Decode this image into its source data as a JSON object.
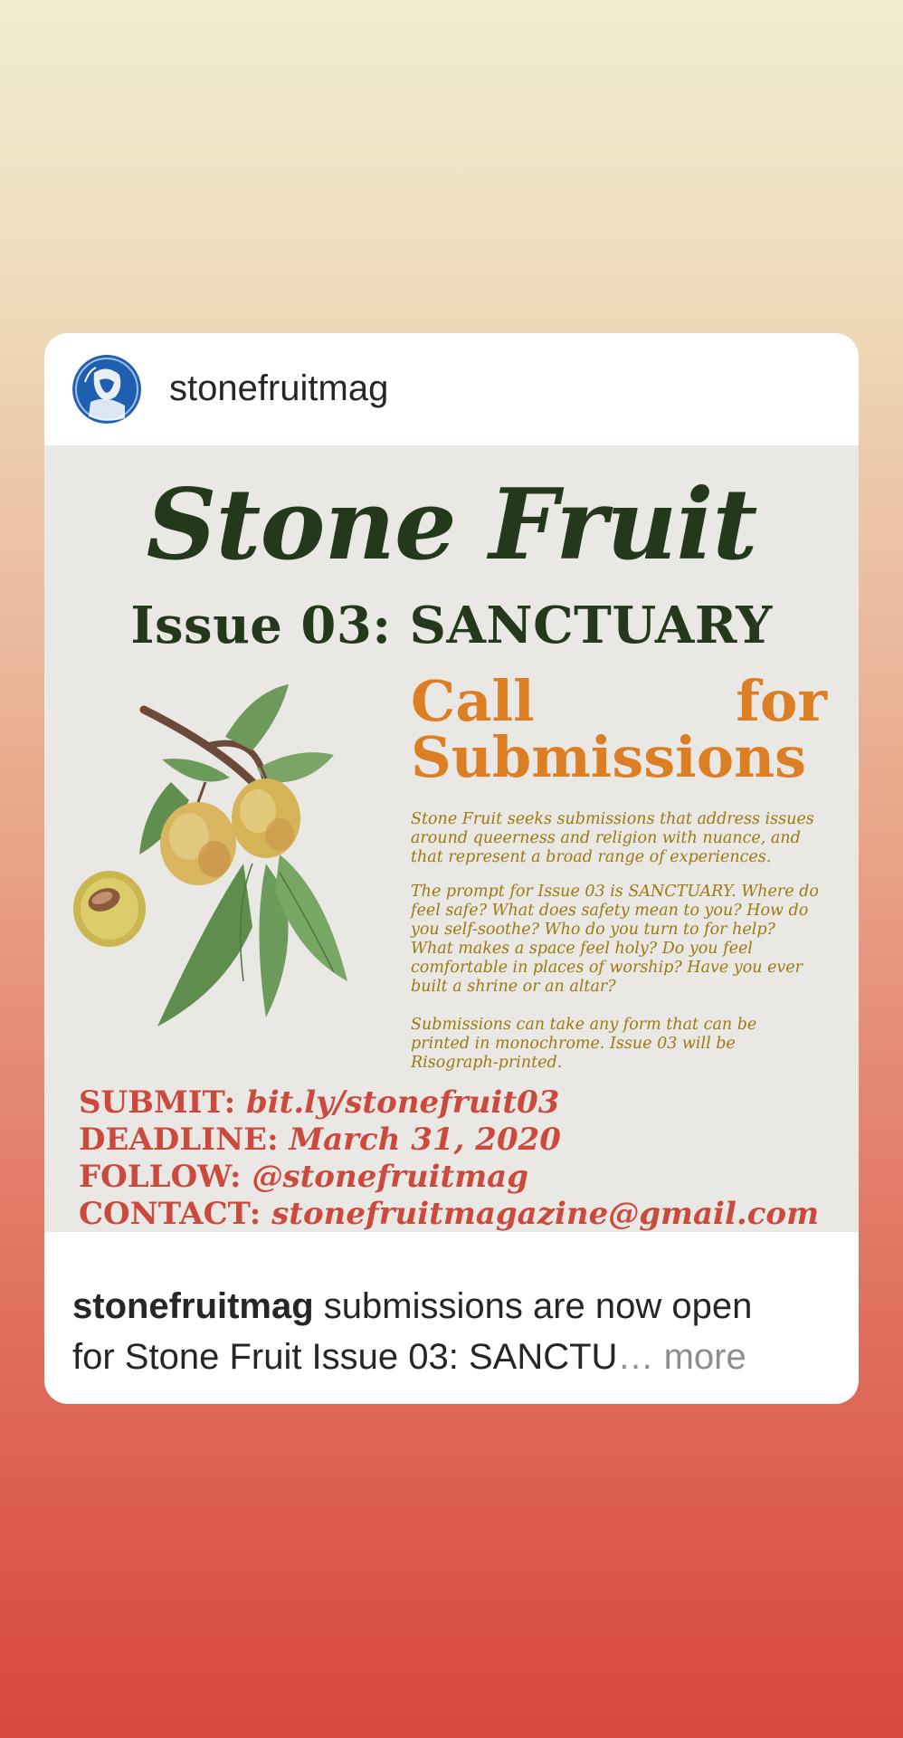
{
  "post": {
    "username": "stonefruitmag",
    "avatar_icon": "avatar-illustration-icon",
    "caption": {
      "username": "stonefruitmag",
      "line1": " submissions are now open",
      "line2": "for Stone Fruit Issue 03: SANCTU",
      "ellipsis": "…",
      "more": " more"
    }
  },
  "poster": {
    "title": "Stone Fruit",
    "issue": "Issue 03: SANCTUARY",
    "cfs_word1": "Call",
    "cfs_word2": "for",
    "cfs_word3": "Submissions",
    "p1_l1": "Stone Fruit seeks submissions that address issues",
    "p1_l2": "around queerness and religion with nuance, and",
    "p1_l3": "that represent a broad range of experiences.",
    "p2_l1": "The prompt for Issue 03 is SANCTUARY. Where do",
    "p2_l2": "feel safe? What does safety mean to you? How do",
    "p2_l3": "you self-soothe? Who do you turn to for help?",
    "p2_l4": "What makes a space feel holy? Do you feel",
    "p2_l5": "comfortable in places of worship? Have you ever",
    "p2_l6": "built a shrine or an altar?",
    "p3_l1": "Submissions can take any form that can be",
    "p3_l2": "printed in monochrome. Issue 03 will be",
    "p3_l3": "Risograph-printed.",
    "submit_label": "SUBMIT: ",
    "submit_value": "bit.ly/stonefruit03",
    "deadline_label": "DEADLINE: ",
    "deadline_value": "March 31, 2020",
    "follow_label": "FOLLOW: ",
    "follow_value": "@stonefruitmag",
    "contact_label": "CONTACT: ",
    "contact_value": "stonefruitmagazine@gmail.com"
  },
  "colors": {
    "title_green": "#24391b",
    "cfs_orange": "#dc7f24",
    "body_gold": "#9e7910",
    "contact_red": "#cc4a3d"
  }
}
